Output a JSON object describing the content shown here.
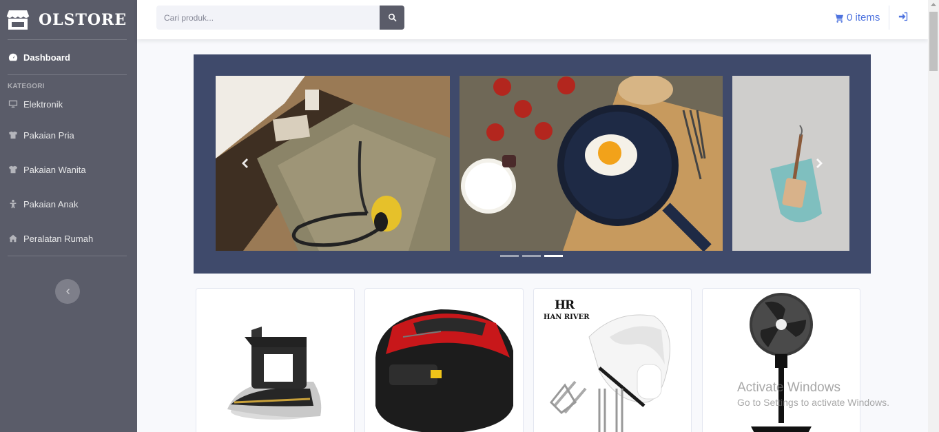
{
  "brand": {
    "name": "OLSTORE"
  },
  "sidebar": {
    "dashboard_label": "Dashboard",
    "category_heading": "KATEGORI",
    "items": [
      {
        "label": "Elektronik",
        "icon": "desktop-icon"
      },
      {
        "label": "Pakaian Pria",
        "icon": "shirt-icon"
      },
      {
        "label": "Pakaian Wanita",
        "icon": "shirt-icon"
      },
      {
        "label": "Pakaian Anak",
        "icon": "child-icon"
      },
      {
        "label": "Peralatan Rumah",
        "icon": "home-icon"
      }
    ]
  },
  "search": {
    "placeholder": "Cari produk..."
  },
  "cart": {
    "label": "0 items"
  },
  "carousel": {
    "slides": 3,
    "active_index": 2
  },
  "products": [
    {
      "name": "iron"
    },
    {
      "name": "rice-cooker"
    },
    {
      "name": "hand-mixer",
      "brand_mono": "HR",
      "brand_name": "HAN RIVER"
    },
    {
      "name": "stand-fan"
    }
  ],
  "watermark": {
    "title": "Activate Windows",
    "subtitle": "Go to Settings to activate Windows."
  },
  "colors": {
    "sidebar": "#5a5c69",
    "accent": "#4e73df",
    "carousel_bg": "#3f4a6b"
  }
}
